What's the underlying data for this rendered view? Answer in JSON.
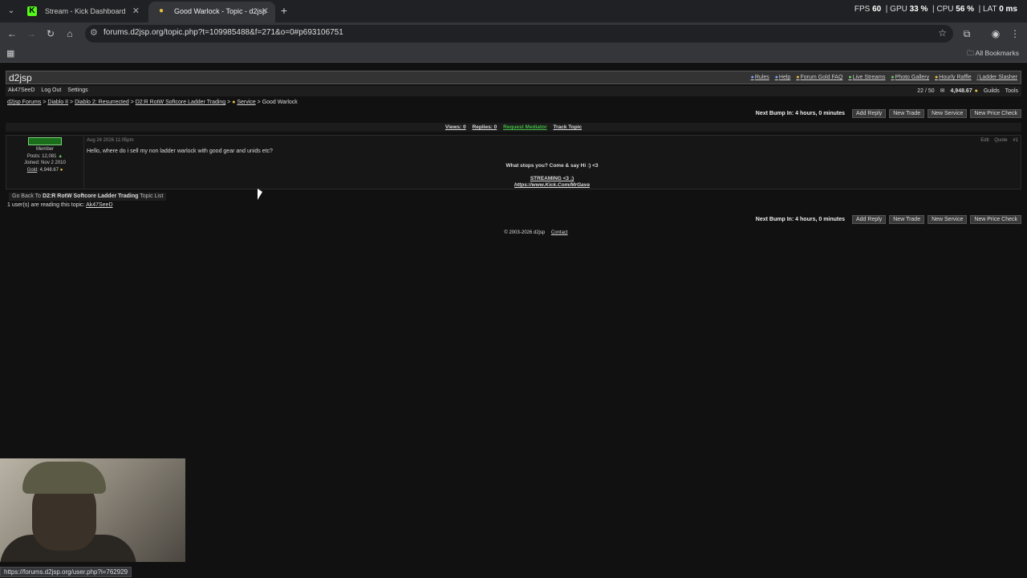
{
  "browser": {
    "tabs": [
      {
        "label": "Stream - Kick Dashboard",
        "favicon": "K"
      },
      {
        "label": "Good Warlock - Topic - d2jsp",
        "favicon": "💛"
      }
    ],
    "url": "forums.d2jsp.org/topic.php?t=109985488&f=271&o=0#p693106751",
    "bookmarks_label": "All Bookmarks",
    "status_url": "https://forums.d2jsp.org/user.php?i=762929"
  },
  "perf": {
    "fps_label": "FPS",
    "fps": "60",
    "gpu_label": "GPU",
    "gpu": "33 %",
    "cpu_label": "CPU",
    "cpu": "56 %",
    "lat_label": "LAT",
    "lat": "0 ms"
  },
  "site": {
    "logo": "d2jsp",
    "nav": [
      "Rules",
      "Help",
      "Forum Gold FAQ",
      "Live Streams",
      "Photo Gallery",
      "Hourly Raffle",
      "Ladder Slasher"
    ],
    "user": {
      "name": "Ak47SeeD",
      "logout": "Log Out",
      "settings": "Settings"
    },
    "pm_count": "22 / 50",
    "gold": "4,948.67",
    "guilds": "Guilds",
    "tools": "Tools"
  },
  "breadcrumb": {
    "items": [
      "d2jsp Forums",
      "Diablo II",
      "Diablo 2: Resurrected",
      "D2:R RotW Softcore Ladder Trading",
      "Service"
    ],
    "current": "Good Warlock"
  },
  "actions": {
    "bump": "Next Bump In: 4 hours, 0 minutes",
    "add_reply": "Add Reply",
    "new_trade": "New Trade",
    "new_service": "New Service",
    "new_price_check": "New Price Check"
  },
  "stats": {
    "views": "Views: 0",
    "replies": "Replies: 0",
    "mediator": "Request Mediator",
    "track": "Track Topic"
  },
  "post": {
    "author_rank": "Member",
    "posts": "Posts: 12,081",
    "joined": "Joined: Nov 2 2010",
    "gold_label": "Gold",
    "gold": ": 4,948.67",
    "date": "Aug 24 2026 11:05pm",
    "edit": "Edit",
    "quote": "Quote",
    "number": "#1",
    "body": "Hello, where do i sell my non ladder warlock with good gear and unids etc?",
    "sig_line1": "What stops you? Come & say Hi :) <3",
    "sig_line2": "STREAMING <3 :)",
    "sig_line3": "https://www.Kick.Com/MrGava"
  },
  "goback": {
    "prefix": "Go Back To",
    "forum": "D2:R RotW Softcore Ladder Trading",
    "suffix": "Topic List"
  },
  "reading": {
    "text": "1 user(s) are reading this topic:",
    "user": "Ak47SeeD"
  },
  "footer": {
    "copyright": "© 2003-2026 d2jsp",
    "contact": "Contact"
  }
}
